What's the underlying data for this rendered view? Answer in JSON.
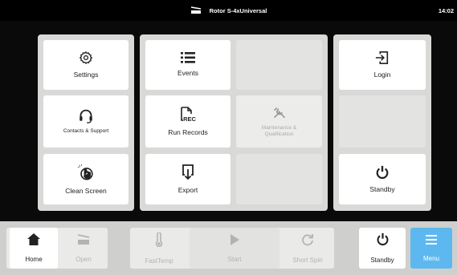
{
  "status_bar": {
    "device_name": "Rotor S-4xUniversal",
    "time": "14:02"
  },
  "menu_panel": {
    "left_tiles": [
      {
        "label": "Settings",
        "icon": "gear-icon"
      },
      {
        "label": "Contacts & Support",
        "icon": "headset-icon"
      },
      {
        "label": "Clean Screen",
        "icon": "hand-touch-icon"
      }
    ],
    "middle_tiles": [
      {
        "label": "Events",
        "icon": "list-icon"
      },
      {
        "label": "Run Records",
        "icon": "record-file-icon",
        "icon_text": "REC"
      },
      {
        "label": "Maintenance & Qualification",
        "icon": "wrench-screwdriver-icon",
        "disabled": true
      },
      {
        "label": "Export",
        "icon": "export-icon"
      }
    ],
    "right_tiles": [
      {
        "label": "Login",
        "icon": "login-icon"
      },
      {
        "label": "Standby",
        "icon": "power-icon"
      }
    ]
  },
  "bottom_nav": {
    "items": [
      {
        "label": "Home",
        "icon": "home-icon",
        "enabled": true
      },
      {
        "label": "Open",
        "icon": "rotor-open-icon",
        "enabled": false
      },
      {
        "label": "FastTemp",
        "icon": "thermometer-icon",
        "enabled": false
      },
      {
        "label": "Start",
        "icon": "play-icon",
        "enabled": false
      },
      {
        "label": "Short Spin",
        "icon": "refresh-icon",
        "enabled": false
      },
      {
        "label": "Standby",
        "icon": "power-icon",
        "enabled": true
      },
      {
        "label": "Menu",
        "icon": "menu-icon",
        "enabled": true
      }
    ]
  },
  "colors": {
    "menu_accent": "#5eb8f0",
    "panel_bg": "#d9dad7",
    "background": "#000000"
  }
}
